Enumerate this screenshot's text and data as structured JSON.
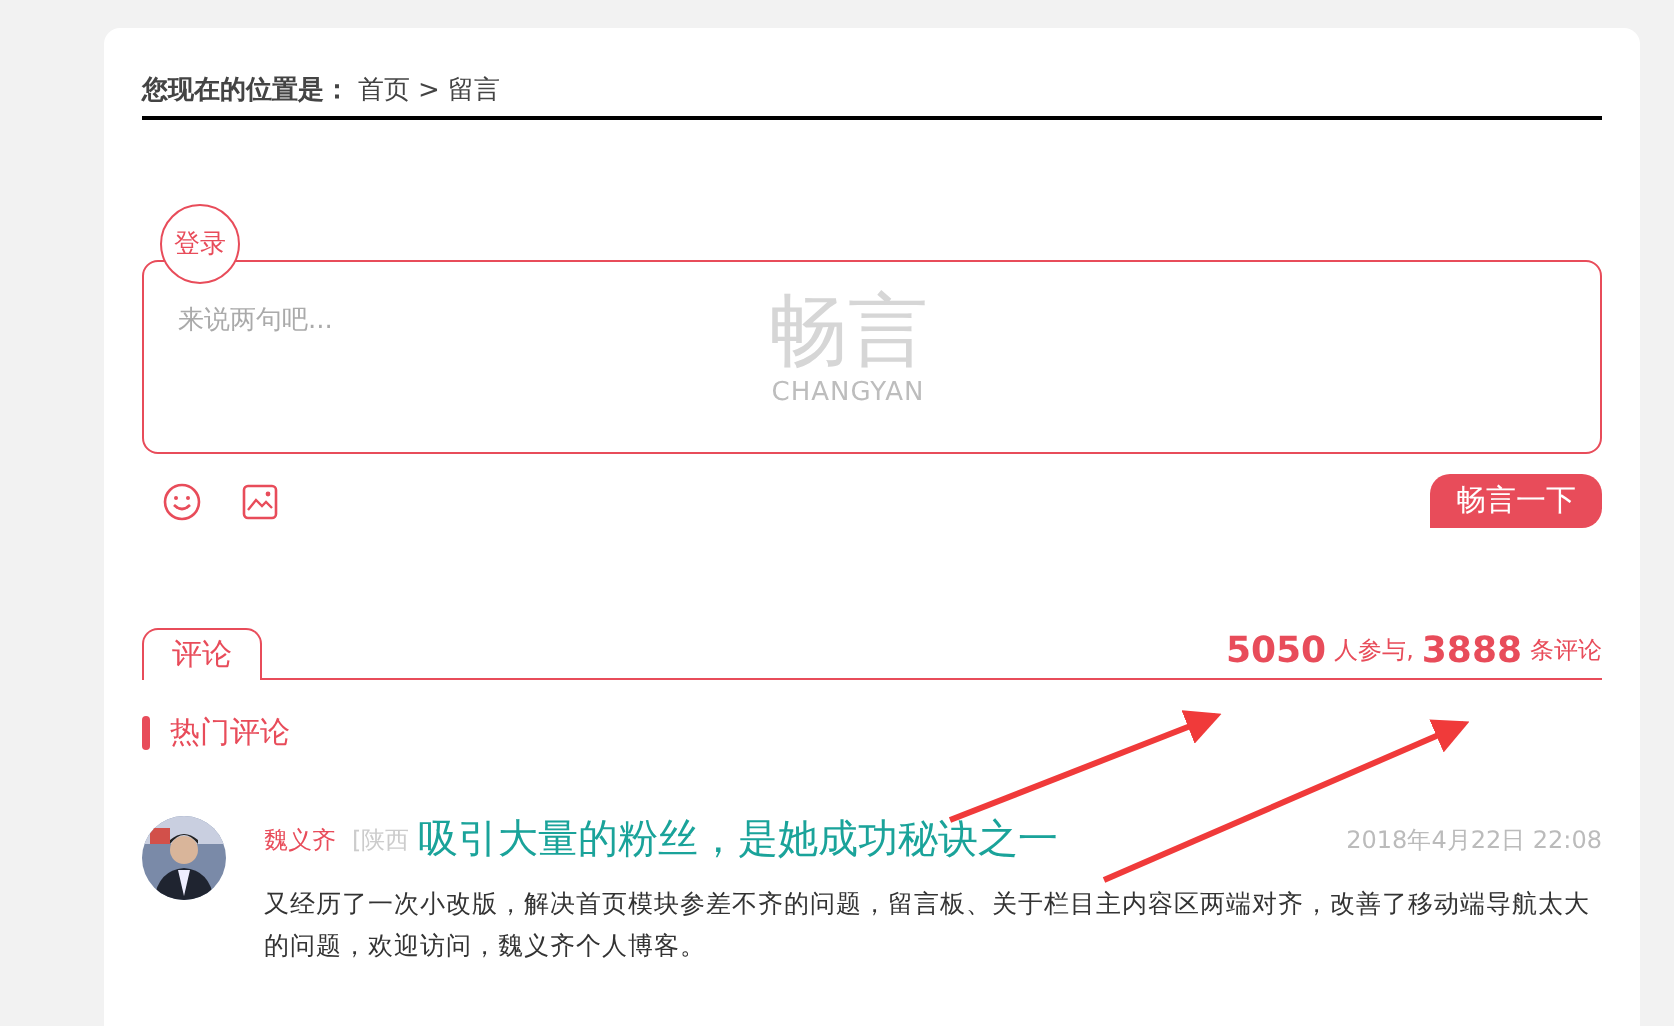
{
  "breadcrumb": {
    "label": "您现在的位置是：",
    "items": [
      "首页",
      "留言"
    ],
    "separator": ">"
  },
  "comment_box": {
    "login": "登录",
    "placeholder": "来说两句吧...",
    "logo_text": "畅言",
    "logo_subtext": "CHANGYAN",
    "submit": "畅言一下"
  },
  "tabs": [
    {
      "label": "评论",
      "selected": true
    }
  ],
  "stats": {
    "participants": "5050",
    "participants_label": "人参与,",
    "comments": "3888",
    "comments_label": "条评论"
  },
  "section_title": "热门评论",
  "comments": [
    {
      "author": "魏义齐",
      "location": "[陕西",
      "time": "2018年4月22日 22:08",
      "text": "又经历了一次小改版，解决首页模块参差不齐的问题，留言板、关于栏目主内容区两端对齐，改善了移动端导航太大的问题，欢迎访问，魏义齐个人博客。"
    }
  ],
  "annotation": "吸引大量的粉丝，是她成功秘诀之一"
}
